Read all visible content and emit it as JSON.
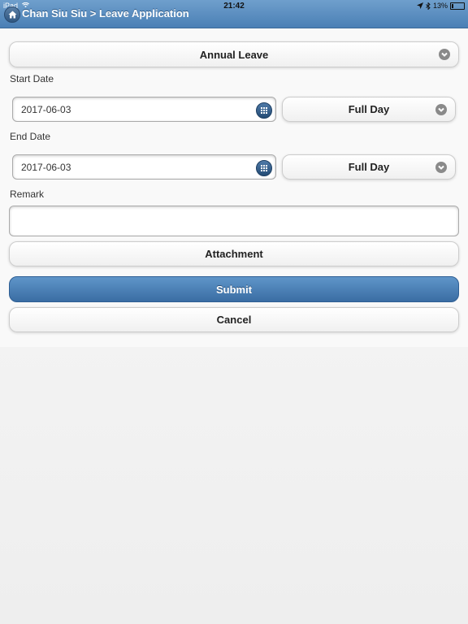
{
  "status_bar": {
    "device": "iPad",
    "time": "21:42",
    "battery": "13%"
  },
  "header": {
    "title": "Chan Siu Siu > Leave Application"
  },
  "form": {
    "leave_type": "Annual Leave",
    "start_date_label": "Start Date",
    "start_date_value": "2017-06-03",
    "start_period": "Full Day",
    "end_date_label": "End Date",
    "end_date_value": "2017-06-03",
    "end_period": "Full Day",
    "remark_label": "Remark",
    "remark_value": "",
    "attachment_label": "Attachment",
    "submit_label": "Submit",
    "cancel_label": "Cancel"
  },
  "icons": {
    "home": "home-icon",
    "calendar": "calendar-icon",
    "select": "chevron-down-icon"
  },
  "colors": {
    "header": "#4a7fb5",
    "submit": "#3a6da3"
  }
}
